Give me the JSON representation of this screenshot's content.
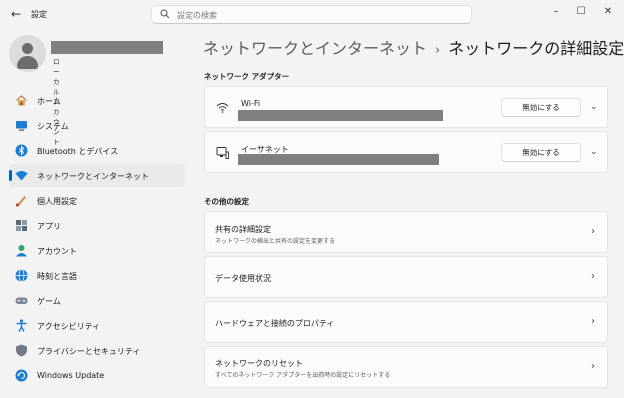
{
  "window": {
    "title": "設定",
    "controls": {
      "minimize": "–",
      "maximize": "☐",
      "close": "✕"
    }
  },
  "search": {
    "placeholder": "設定の検索"
  },
  "profile": {
    "account_type": "ローカル アカウント"
  },
  "sidebar": {
    "items": [
      {
        "label": "ホーム",
        "icon": "home-icon",
        "active": false
      },
      {
        "label": "システム",
        "icon": "system-icon",
        "active": false
      },
      {
        "label": "Bluetooth とデバイス",
        "icon": "bluetooth-icon",
        "active": false
      },
      {
        "label": "ネットワークとインターネット",
        "icon": "network-icon",
        "active": true
      },
      {
        "label": "個人用設定",
        "icon": "personalization-icon",
        "active": false
      },
      {
        "label": "アプリ",
        "icon": "apps-icon",
        "active": false
      },
      {
        "label": "アカウント",
        "icon": "account-icon",
        "active": false
      },
      {
        "label": "時刻と言語",
        "icon": "time-language-icon",
        "active": false
      },
      {
        "label": "ゲーム",
        "icon": "gaming-icon",
        "active": false
      },
      {
        "label": "アクセシビリティ",
        "icon": "accessibility-icon",
        "active": false
      },
      {
        "label": "プライバシーとセキュリティ",
        "icon": "privacy-shield-icon",
        "active": false
      },
      {
        "label": "Windows Update",
        "icon": "windows-update-icon",
        "active": false
      }
    ]
  },
  "header": {
    "breadcrumb": "ネットワークとインターネット",
    "separator": "›",
    "title": "ネットワークの詳細設定"
  },
  "adapters": {
    "heading": "ネットワーク アダプター",
    "items": [
      {
        "name": "Wi-Fi",
        "icon": "wifi-icon",
        "button_label": "無効にする"
      },
      {
        "name": "イーサネット",
        "icon": "ethernet-icon",
        "button_label": "無効にする"
      }
    ]
  },
  "more_settings": {
    "heading": "その他の設定",
    "items": [
      {
        "title": "共有の詳細設定",
        "subtitle": "ネットワークの検出と共有の設定を変更する"
      },
      {
        "title": "データ使用状況",
        "subtitle": ""
      },
      {
        "title": "ハードウェアと接続のプロパティ",
        "subtitle": ""
      },
      {
        "title": "ネットワークのリセット",
        "subtitle": "すべてのネットワーク アダプターを出荷時の設定にリセットする"
      }
    ]
  },
  "colors": {
    "accent": "#0067c0",
    "background": "#f3f3f3",
    "card": "#fbfbfb"
  }
}
